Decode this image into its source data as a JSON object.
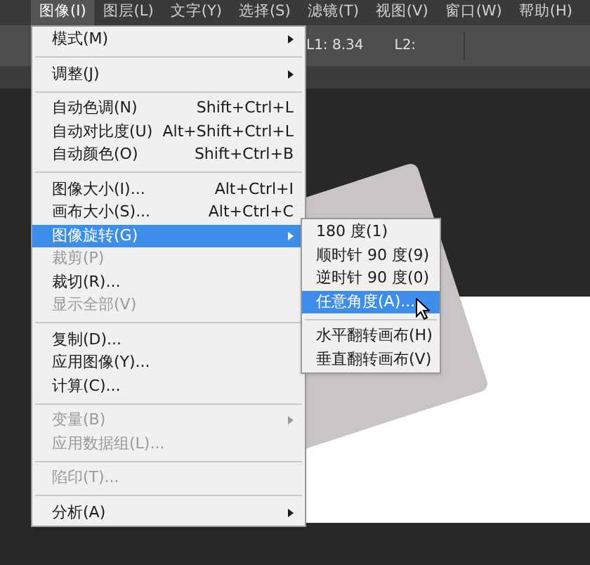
{
  "menubar": [
    {
      "label": "图像(I)",
      "selected": true
    },
    {
      "label": "图层(L)",
      "selected": false
    },
    {
      "label": "文字(Y)",
      "selected": false
    },
    {
      "label": "选择(S)",
      "selected": false
    },
    {
      "label": "滤镜(T)",
      "selected": false
    },
    {
      "label": "视图(V)",
      "selected": false
    },
    {
      "label": "窗口(W)",
      "selected": false
    },
    {
      "label": "帮助(H)",
      "selected": false
    }
  ],
  "options_bar": {
    "fields": [
      "L1: 8.34",
      "L2:"
    ]
  },
  "menu": {
    "items": [
      {
        "kind": "item",
        "label": "模式(M)",
        "submenu": true,
        "disabled": false,
        "selected": false
      },
      {
        "kind": "separator"
      },
      {
        "kind": "item",
        "label": "调整(J)",
        "submenu": true,
        "disabled": false,
        "selected": false
      },
      {
        "kind": "separator"
      },
      {
        "kind": "item",
        "label": "自动色调(N)",
        "shortcut": "Shift+Ctrl+L",
        "submenu": false,
        "disabled": false,
        "selected": false
      },
      {
        "kind": "item",
        "label": "自动对比度(U)",
        "shortcut": "Alt+Shift+Ctrl+L",
        "submenu": false,
        "disabled": false,
        "selected": false
      },
      {
        "kind": "item",
        "label": "自动颜色(O)",
        "shortcut": "Shift+Ctrl+B",
        "submenu": false,
        "disabled": false,
        "selected": false
      },
      {
        "kind": "separator"
      },
      {
        "kind": "item",
        "label": "图像大小(I)...",
        "shortcut": "Alt+Ctrl+I",
        "submenu": false,
        "disabled": false,
        "selected": false
      },
      {
        "kind": "item",
        "label": "画布大小(S)...",
        "shortcut": "Alt+Ctrl+C",
        "submenu": false,
        "disabled": false,
        "selected": false
      },
      {
        "kind": "item",
        "label": "图像旋转(G)",
        "submenu": true,
        "disabled": false,
        "selected": true
      },
      {
        "kind": "item",
        "label": "裁剪(P)",
        "submenu": false,
        "disabled": true,
        "selected": false
      },
      {
        "kind": "item",
        "label": "裁切(R)...",
        "submenu": false,
        "disabled": false,
        "selected": false
      },
      {
        "kind": "item",
        "label": "显示全部(V)",
        "submenu": false,
        "disabled": true,
        "selected": false
      },
      {
        "kind": "separator"
      },
      {
        "kind": "item",
        "label": "复制(D)...",
        "submenu": false,
        "disabled": false,
        "selected": false
      },
      {
        "kind": "item",
        "label": "应用图像(Y)...",
        "submenu": false,
        "disabled": false,
        "selected": false
      },
      {
        "kind": "item",
        "label": "计算(C)...",
        "submenu": false,
        "disabled": false,
        "selected": false
      },
      {
        "kind": "separator"
      },
      {
        "kind": "item",
        "label": "变量(B)",
        "submenu": true,
        "disabled": true,
        "selected": false
      },
      {
        "kind": "item",
        "label": "应用数据组(L)...",
        "submenu": false,
        "disabled": true,
        "selected": false
      },
      {
        "kind": "separator"
      },
      {
        "kind": "item",
        "label": "陷印(T)...",
        "submenu": false,
        "disabled": true,
        "selected": false
      },
      {
        "kind": "separator"
      },
      {
        "kind": "item",
        "label": "分析(A)",
        "submenu": true,
        "disabled": false,
        "selected": false
      }
    ]
  },
  "submenu": {
    "items": [
      {
        "kind": "item",
        "label": "180 度(1)",
        "selected": false
      },
      {
        "kind": "item",
        "label": "顺时针 90 度(9)",
        "selected": false
      },
      {
        "kind": "item",
        "label": "逆时针 90 度(0)",
        "selected": false
      },
      {
        "kind": "item",
        "label": "任意角度(A)...",
        "selected": true
      },
      {
        "kind": "separator"
      },
      {
        "kind": "item",
        "label": "水平翻转画布(H)",
        "selected": false
      },
      {
        "kind": "item",
        "label": "垂直翻转画布(V)",
        "selected": false
      }
    ]
  }
}
